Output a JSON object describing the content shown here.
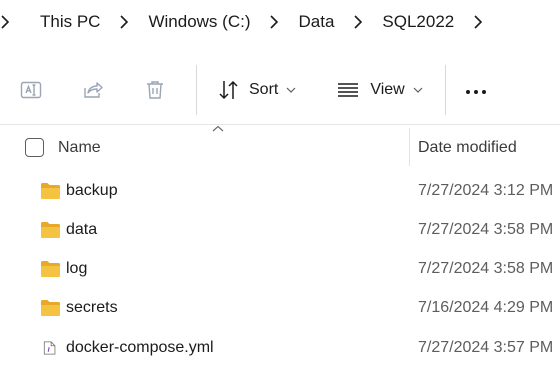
{
  "breadcrumb": {
    "items": [
      {
        "label": "This PC"
      },
      {
        "label": "Windows (C:)"
      },
      {
        "label": "Data"
      },
      {
        "label": "SQL2022"
      }
    ]
  },
  "toolbar": {
    "rename_icon": "rename-icon",
    "share_icon": "share-icon",
    "delete_icon": "trash-icon",
    "sort_label": "Sort",
    "view_label": "View",
    "more_icon": "more-icon"
  },
  "columns": {
    "name": "Name",
    "date_modified": "Date modified"
  },
  "files": [
    {
      "name": "backup",
      "date": "7/27/2024 3:12 PM",
      "type": "folder"
    },
    {
      "name": "data",
      "date": "7/27/2024 3:58 PM",
      "type": "folder"
    },
    {
      "name": "log",
      "date": "7/27/2024 3:58 PM",
      "type": "folder"
    },
    {
      "name": "secrets",
      "date": "7/16/2024 4:29 PM",
      "type": "folder"
    },
    {
      "name": "docker-compose.yml",
      "date": "7/27/2024 3:57 PM",
      "type": "file"
    }
  ],
  "colors": {
    "folder": "#f5c342",
    "folder_dark": "#e8a92a",
    "disabled_icon": "#9aa6b3",
    "file_accent": "#7a4fb5"
  }
}
